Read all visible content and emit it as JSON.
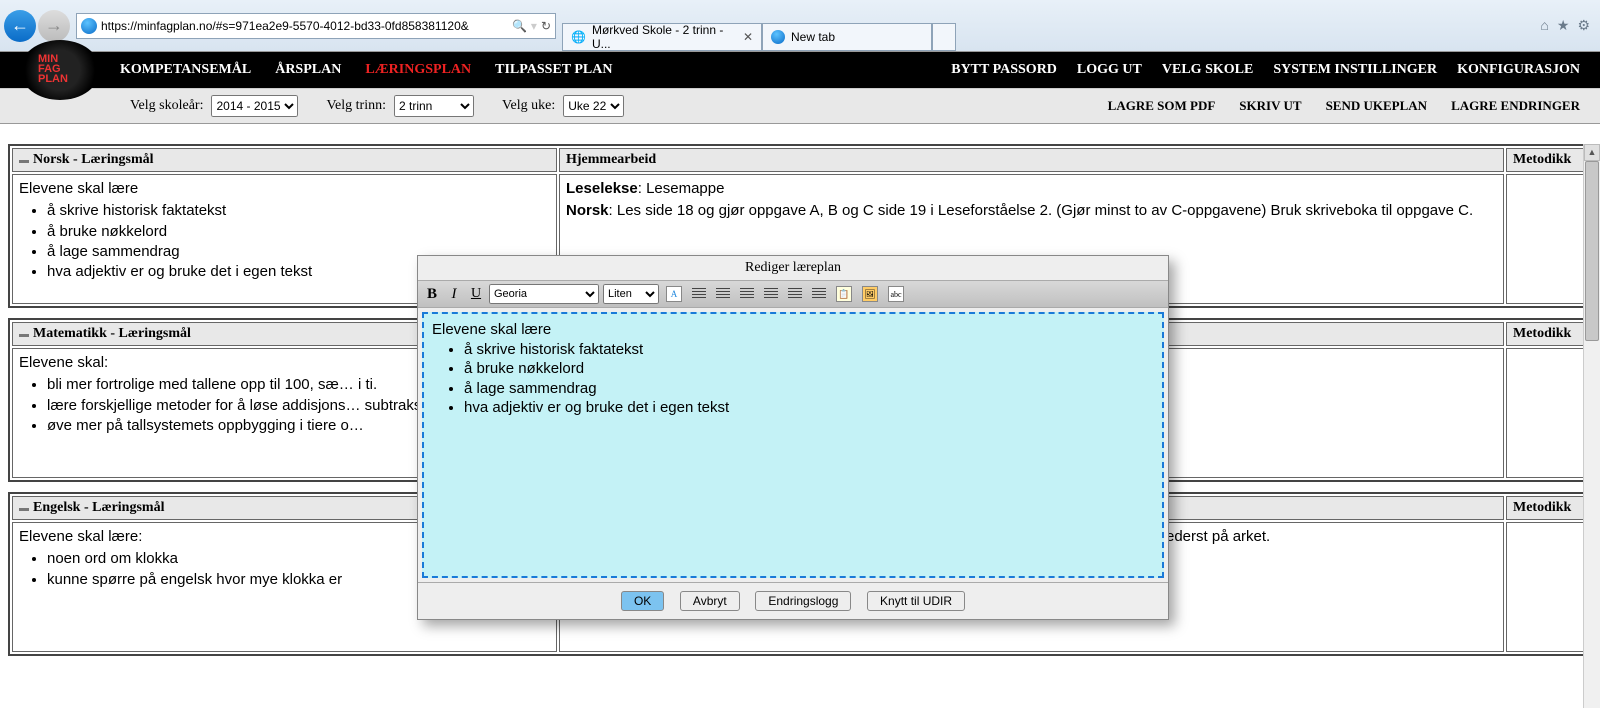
{
  "browser": {
    "url": "https://minfagplan.no/#s=971ea2e9-5570-4012-bd33-0fd858381120&",
    "search_glyph": "🔍",
    "refresh_glyph": "↻",
    "lock_glyph": "🔒",
    "tabs": [
      {
        "title": "Mørkved Skole - 2 trinn - U...",
        "closeable": true
      },
      {
        "title": "New tab",
        "closeable": false
      }
    ],
    "home": "⌂",
    "star": "★",
    "gear": "⚙"
  },
  "win": {
    "min": "—",
    "max": "❐",
    "close": "✕"
  },
  "nav": {
    "items": [
      "KOMPETANSEMÅL",
      "ÅRSPLAN",
      "LÆRINGSPLAN",
      "TILPASSET PLAN"
    ],
    "active_index": 2,
    "right": [
      "BYTT PASSORD",
      "LOGG UT",
      "VELG SKOLE",
      "SYSTEM INSTILLINGER",
      "KONFIGURASJON"
    ]
  },
  "filters": {
    "year_label": "Velg skoleår:",
    "year_value": "2014 - 2015",
    "trinn_label": "Velg trinn:",
    "trinn_value": "2 trinn",
    "uke_label": "Velg uke:",
    "uke_value": "Uke 22",
    "actions": [
      "LAGRE SOM PDF",
      "SKRIV UT",
      "SEND UKEPLAN",
      "LAGRE ENDRINGER"
    ]
  },
  "columns": {
    "hjemme": "Hjemmearbeid",
    "metodikk": "Metodikk"
  },
  "sections": {
    "norsk": {
      "title": "Norsk - Læringsmål",
      "intro": "Elevene skal lære",
      "bullets": [
        "å skrive historisk faktatekst",
        "å bruke nøkkelord",
        "å lage sammendrag",
        "hva adjektiv er og bruke det i egen tekst"
      ],
      "hjemme_html1_label": "Leselekse",
      "hjemme_html1_text": ": Lesemappe",
      "hjemme_html2_label": "Norsk",
      "hjemme_html2_text": ": Les side 18 og gjør oppgave A, B og C side 19 i Leseforståelse 2. (Gjør minst to av C-oppgavene) Bruk skriveboka til oppgave C."
    },
    "matte": {
      "title": "Matematikk - Læringsmål",
      "intro": "Elevene skal:",
      "bullets": [
        "bli mer fortrolige med tallene opp til 100, sæ… i ti.",
        "lære forskjellige metoder for å løse addisjons… subtraksjonsoppgaver.",
        "øve mer på tallsystemets oppbygging i tiere o…"
      ]
    },
    "engelsk": {
      "title": "Engelsk - Læringsmål",
      "intro": "Elevene skal lære:",
      "bullets": [
        "noen ord om klokka",
        "kunne spørre på engelsk hvor mye klokka er"
      ],
      "hjemme_fragment": "ederst på arket."
    }
  },
  "modal": {
    "title": "Rediger læreplan",
    "font_select": "Georia",
    "size_select": "Liten",
    "editor_intro": "Elevene skal lære",
    "editor_bullets": [
      "å skrive historisk faktatekst",
      "å bruke nøkkelord",
      "å lage sammendrag",
      "hva adjektiv er og bruke det i egen tekst"
    ],
    "buttons": {
      "ok": "OK",
      "cancel": "Avbryt",
      "log": "Endringslogg",
      "udir": "Knytt til UDIR"
    }
  }
}
